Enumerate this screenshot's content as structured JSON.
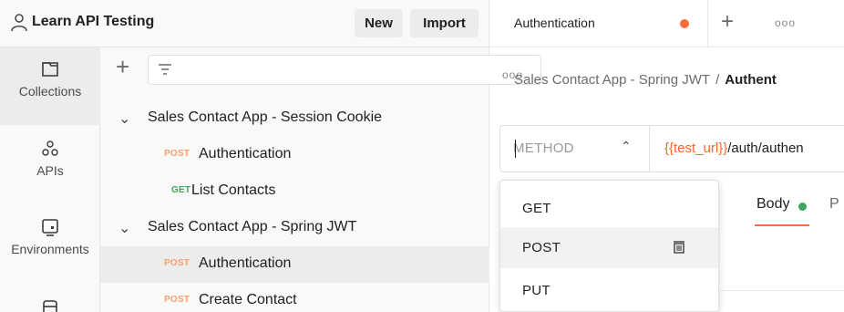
{
  "header": {
    "workspace_title": "Learn API Testing",
    "new_label": "New",
    "import_label": "Import"
  },
  "rail": {
    "items": [
      {
        "label": "Collections",
        "icon": "collection-icon",
        "active": true
      },
      {
        "label": "APIs",
        "icon": "api-icon",
        "active": false
      },
      {
        "label": "Environments",
        "icon": "environment-icon",
        "active": false
      },
      {
        "label": "",
        "icon": "mock-server-icon",
        "active": false
      }
    ]
  },
  "tree": {
    "add_icon": "+",
    "more_icon": "ooo",
    "rows": [
      {
        "type": "collection",
        "name": "Sales Contact App - Session Cookie"
      },
      {
        "type": "request",
        "method": "POST",
        "name": "Authentication"
      },
      {
        "type": "request",
        "method": "GET",
        "name": "List Contacts"
      },
      {
        "type": "collection",
        "name": "Sales Contact App - Spring JWT"
      },
      {
        "type": "request",
        "method": "POST",
        "name": "Authentication",
        "selected": true
      },
      {
        "type": "request",
        "method": "POST",
        "name": "Create Contact"
      }
    ]
  },
  "tabs": {
    "active_tab": "Authentication",
    "more_icon": "ooo",
    "add_icon": "+"
  },
  "breadcrumb": {
    "collection": "Sales Contact App - Spring JWT",
    "separator": "/",
    "current": "Authent"
  },
  "request": {
    "method_placeholder": "METHOD",
    "url_variable": "{{test_url}}",
    "url_path": "/auth/authen"
  },
  "subtabs": {
    "paren": ")",
    "body": "Body",
    "next": "P"
  },
  "method_dropdown": {
    "options": [
      "GET",
      "POST",
      "PUT"
    ],
    "hovered": "POST"
  },
  "colors": {
    "accent": "#ff6c37",
    "post": "#f5a26b",
    "get": "#3aa55c",
    "variable": "#f06a2b"
  }
}
